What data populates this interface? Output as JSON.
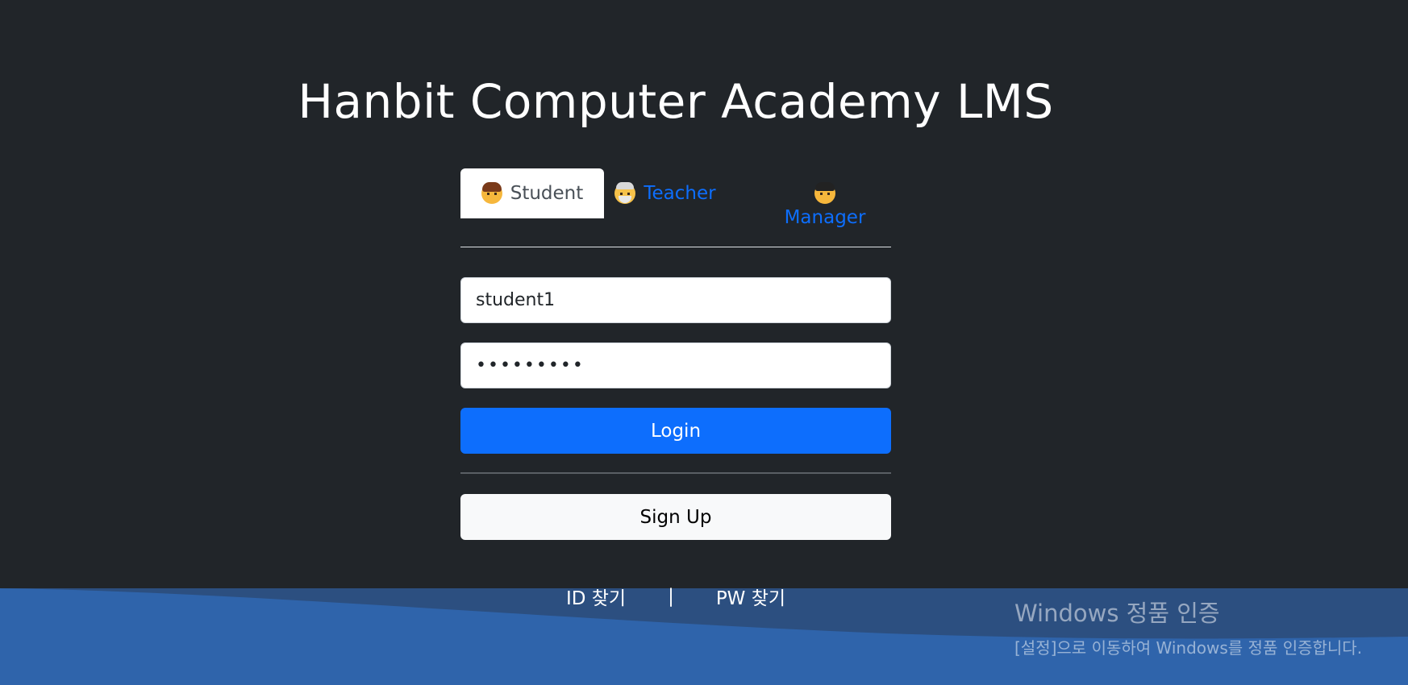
{
  "page": {
    "title": "Hanbit Computer Academy LMS"
  },
  "tabs": [
    {
      "label": "Student",
      "icon": "student-emoji-icon",
      "active": true
    },
    {
      "label": "Teacher",
      "icon": "teacher-emoji-icon",
      "active": false
    },
    {
      "label": "Manager",
      "icon": "manager-emoji-icon",
      "active": false
    }
  ],
  "form": {
    "id_value": "student1",
    "password_value": "•••••••••",
    "login_label": "Login",
    "signup_label": "Sign Up"
  },
  "links": {
    "find_id": "ID 찾기",
    "separator": "|",
    "find_pw": "PW 찾기"
  },
  "watermark": {
    "title": "Windows 정품 인증",
    "subtitle": "[설정]으로 이동하여 Windows를 정품 인증합니다."
  },
  "colors": {
    "background": "#212529",
    "primary": "#0d6efd",
    "wave": "#2f64ab"
  }
}
